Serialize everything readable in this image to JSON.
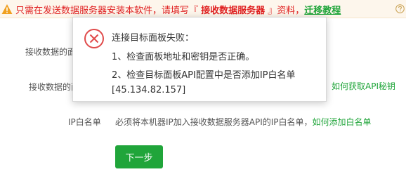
{
  "warning": {
    "text_before": "只需在发送数据服务器安装本软件，请填写『 ",
    "highlight": "接收数据服务器",
    "text_after": " 』资料，",
    "link": "迁移教程"
  },
  "form": {
    "label_1": "接收数据的面",
    "label_2": "接收数据的面",
    "api_key_link": "如何获取API秘钥",
    "ip_whitelist_label": "IP白名单",
    "ip_hint": "必须将本机器IP加入接收数据服务器API的IP白名单，",
    "ip_hint_link": "如何添加白名单"
  },
  "next_button": "下一步",
  "dialog": {
    "title": "连接目标面板失败：",
    "line_1": "1、检查面板地址和密钥是否正确。",
    "line_2": "2、检查目标面板API配置中是否添加IP白名单",
    "line_3": "[45.134.82.157]"
  },
  "colors": {
    "accent_green": "#20a53a",
    "warning_red": "#e02020",
    "warning_bg": "#fdf6ec",
    "error_icon": "#e04b4b"
  }
}
